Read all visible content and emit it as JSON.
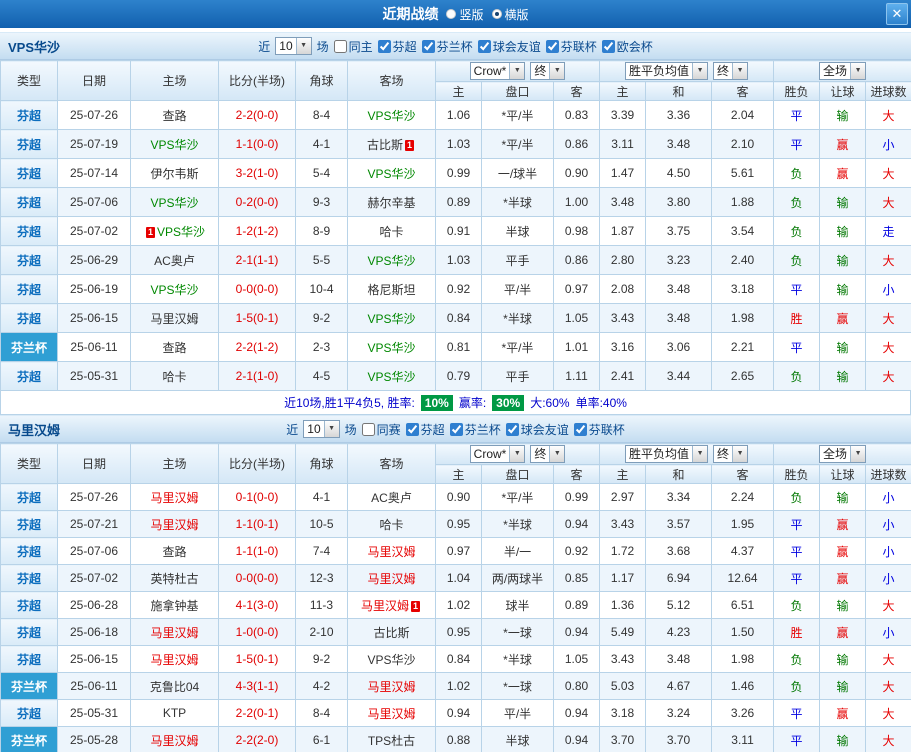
{
  "titlebar": {
    "title": "近期战绩",
    "vertical_label": "竖版",
    "horizontal_label": "横版",
    "selected_layout": "横版",
    "close_glyph": "✕"
  },
  "icons": {
    "chevron_down": "▼"
  },
  "colors": {
    "highlight_home_team": "#e60000",
    "highlight_away_team": "#008800",
    "result_win": "#e60000",
    "result_draw": "#0000e0",
    "result_lose": "#007700",
    "rate_badge_bg": "#009944",
    "cup_type_bg": "#2f9fd4",
    "titlebar_bg": "#1a6fbd"
  },
  "table_headers": {
    "type": "类型",
    "date": "日期",
    "home": "主场",
    "score": "比分(半场)",
    "corner": "角球",
    "away": "客场",
    "bookmaker": "Crow*",
    "final": "终",
    "avg": "胜平负均值",
    "fulltime": "全场",
    "sub_home": "主",
    "sub_handicap": "盘口",
    "sub_away": "客",
    "sub_avg_home": "主",
    "sub_avg_draw": "和",
    "sub_avg_away": "客",
    "sub_result": "胜负",
    "sub_handicap_result": "让球",
    "sub_goals": "进球数"
  },
  "sections": [
    {
      "team": "VPS华沙",
      "filters": {
        "near_label": "近",
        "count": "10",
        "games_label": "场",
        "same_label": "同主",
        "leagues": [
          "芬超",
          "芬兰杯",
          "球会友谊",
          "芬联杯",
          "欧会杯"
        ]
      },
      "rows": [
        {
          "type": "芬超",
          "date": "25-07-26",
          "home": {
            "name": "查路"
          },
          "score": "2-2(0-0)",
          "corner": "8-4",
          "away": {
            "name": "VPS华沙",
            "hl": "green"
          },
          "odds": [
            "1.06",
            "*平/半",
            "0.83",
            "3.39",
            "3.36",
            "2.04"
          ],
          "res": [
            "平",
            "输",
            "大"
          ]
        },
        {
          "type": "芬超",
          "date": "25-07-19",
          "home": {
            "name": "VPS华沙",
            "hl": "green"
          },
          "score": "1-1(0-0)",
          "corner": "4-1",
          "away": {
            "name": "古比斯",
            "card_after": "1"
          },
          "odds": [
            "1.03",
            "*平/半",
            "0.86",
            "3.11",
            "3.48",
            "2.10"
          ],
          "res": [
            "平",
            "赢",
            "小"
          ]
        },
        {
          "type": "芬超",
          "date": "25-07-14",
          "home": {
            "name": "伊尔韦斯"
          },
          "score": "3-2(1-0)",
          "corner": "5-4",
          "away": {
            "name": "VPS华沙",
            "hl": "green"
          },
          "odds": [
            "0.99",
            "一/球半",
            "0.90",
            "1.47",
            "4.50",
            "5.61"
          ],
          "res": [
            "负",
            "赢",
            "大"
          ]
        },
        {
          "type": "芬超",
          "date": "25-07-06",
          "home": {
            "name": "VPS华沙",
            "hl": "green"
          },
          "score": "0-2(0-0)",
          "corner": "9-3",
          "away": {
            "name": "赫尔辛基"
          },
          "odds": [
            "0.89",
            "*半球",
            "1.00",
            "3.48",
            "3.80",
            "1.88"
          ],
          "res": [
            "负",
            "输",
            "大"
          ]
        },
        {
          "type": "芬超",
          "date": "25-07-02",
          "home": {
            "name": "VPS华沙",
            "hl": "green",
            "card_before": "1"
          },
          "score": "1-2(1-2)",
          "corner": "8-9",
          "away": {
            "name": "哈卡"
          },
          "odds": [
            "0.91",
            "半球",
            "0.98",
            "1.87",
            "3.75",
            "3.54"
          ],
          "res": [
            "负",
            "输",
            "走"
          ]
        },
        {
          "type": "芬超",
          "date": "25-06-29",
          "home": {
            "name": "AC奥卢"
          },
          "score": "2-1(1-1)",
          "corner": "5-5",
          "away": {
            "name": "VPS华沙",
            "hl": "green"
          },
          "odds": [
            "1.03",
            "平手",
            "0.86",
            "2.80",
            "3.23",
            "2.40"
          ],
          "res": [
            "负",
            "输",
            "大"
          ]
        },
        {
          "type": "芬超",
          "date": "25-06-19",
          "home": {
            "name": "VPS华沙",
            "hl": "green"
          },
          "score": "0-0(0-0)",
          "corner": "10-4",
          "away": {
            "name": "格尼斯坦"
          },
          "odds": [
            "0.92",
            "平/半",
            "0.97",
            "2.08",
            "3.48",
            "3.18"
          ],
          "res": [
            "平",
            "输",
            "小"
          ]
        },
        {
          "type": "芬超",
          "date": "25-06-15",
          "home": {
            "name": "马里汉姆"
          },
          "score": "1-5(0-1)",
          "corner": "9-2",
          "away": {
            "name": "VPS华沙",
            "hl": "green"
          },
          "odds": [
            "0.84",
            "*半球",
            "1.05",
            "3.43",
            "3.48",
            "1.98"
          ],
          "res": [
            "胜",
            "赢",
            "大"
          ]
        },
        {
          "type": "芬兰杯",
          "date": "25-06-11",
          "home": {
            "name": "查路"
          },
          "score": "2-2(1-2)",
          "corner": "2-3",
          "away": {
            "name": "VPS华沙",
            "hl": "green"
          },
          "odds": [
            "0.81",
            "*平/半",
            "1.01",
            "3.16",
            "3.06",
            "2.21"
          ],
          "res": [
            "平",
            "输",
            "大"
          ]
        },
        {
          "type": "芬超",
          "date": "25-05-31",
          "home": {
            "name": "哈卡"
          },
          "score": "2-1(1-0)",
          "corner": "4-5",
          "away": {
            "name": "VPS华沙",
            "hl": "green"
          },
          "odds": [
            "0.79",
            "平手",
            "1.11",
            "2.41",
            "3.44",
            "2.65"
          ],
          "res": [
            "负",
            "输",
            "大"
          ]
        }
      ],
      "summary": {
        "prefix": "近10场,胜1平4负5, 胜率:",
        "win_rate": "10%",
        "asia_label": "赢率:",
        "asia_rate": "30%",
        "big_text": "大:60%",
        "single_text": "单率:40%"
      }
    },
    {
      "team": "马里汉姆",
      "filters": {
        "near_label": "近",
        "count": "10",
        "games_label": "场",
        "same_label": "同赛",
        "leagues": [
          "芬超",
          "芬兰杯",
          "球会友谊",
          "芬联杯"
        ]
      },
      "rows": [
        {
          "type": "芬超",
          "date": "25-07-26",
          "home": {
            "name": "马里汉姆",
            "hl": "red"
          },
          "score": "0-1(0-0)",
          "corner": "4-1",
          "away": {
            "name": "AC奥卢"
          },
          "odds": [
            "0.90",
            "*平/半",
            "0.99",
            "2.97",
            "3.34",
            "2.24"
          ],
          "res": [
            "负",
            "输",
            "小"
          ]
        },
        {
          "type": "芬超",
          "date": "25-07-21",
          "home": {
            "name": "马里汉姆",
            "hl": "red"
          },
          "score": "1-1(0-1)",
          "corner": "10-5",
          "away": {
            "name": "哈卡"
          },
          "odds": [
            "0.95",
            "*半球",
            "0.94",
            "3.43",
            "3.57",
            "1.95"
          ],
          "res": [
            "平",
            "赢",
            "小"
          ]
        },
        {
          "type": "芬超",
          "date": "25-07-06",
          "home": {
            "name": "查路"
          },
          "score": "1-1(1-0)",
          "corner": "7-4",
          "away": {
            "name": "马里汉姆",
            "hl": "red"
          },
          "odds": [
            "0.97",
            "半/一",
            "0.92",
            "1.72",
            "3.68",
            "4.37"
          ],
          "res": [
            "平",
            "赢",
            "小"
          ]
        },
        {
          "type": "芬超",
          "date": "25-07-02",
          "home": {
            "name": "英特杜古"
          },
          "score": "0-0(0-0)",
          "corner": "12-3",
          "away": {
            "name": "马里汉姆",
            "hl": "red"
          },
          "odds": [
            "1.04",
            "两/两球半",
            "0.85",
            "1.17",
            "6.94",
            "12.64"
          ],
          "res": [
            "平",
            "赢",
            "小"
          ]
        },
        {
          "type": "芬超",
          "date": "25-06-28",
          "home": {
            "name": "施拿钟基"
          },
          "score": "4-1(3-0)",
          "corner": "11-3",
          "away": {
            "name": "马里汉姆",
            "hl": "red",
            "card_after": "1"
          },
          "odds": [
            "1.02",
            "球半",
            "0.89",
            "1.36",
            "5.12",
            "6.51"
          ],
          "res": [
            "负",
            "输",
            "大"
          ]
        },
        {
          "type": "芬超",
          "date": "25-06-18",
          "home": {
            "name": "马里汉姆",
            "hl": "red"
          },
          "score": "1-0(0-0)",
          "corner": "2-10",
          "away": {
            "name": "古比斯"
          },
          "odds": [
            "0.95",
            "*一球",
            "0.94",
            "5.49",
            "4.23",
            "1.50"
          ],
          "res": [
            "胜",
            "赢",
            "小"
          ]
        },
        {
          "type": "芬超",
          "date": "25-06-15",
          "home": {
            "name": "马里汉姆",
            "hl": "red"
          },
          "score": "1-5(0-1)",
          "corner": "9-2",
          "away": {
            "name": "VPS华沙"
          },
          "odds": [
            "0.84",
            "*半球",
            "1.05",
            "3.43",
            "3.48",
            "1.98"
          ],
          "res": [
            "负",
            "输",
            "大"
          ]
        },
        {
          "type": "芬兰杯",
          "date": "25-06-11",
          "home": {
            "name": "克鲁比04"
          },
          "score": "4-3(1-1)",
          "corner": "4-2",
          "away": {
            "name": "马里汉姆",
            "hl": "red"
          },
          "odds": [
            "1.02",
            "*一球",
            "0.80",
            "5.03",
            "4.67",
            "1.46"
          ],
          "res": [
            "负",
            "输",
            "大"
          ]
        },
        {
          "type": "芬超",
          "date": "25-05-31",
          "home": {
            "name": "KTP"
          },
          "score": "2-2(0-1)",
          "corner": "8-4",
          "away": {
            "name": "马里汉姆",
            "hl": "red"
          },
          "odds": [
            "0.94",
            "平/半",
            "0.94",
            "3.18",
            "3.24",
            "3.26"
          ],
          "res": [
            "平",
            "赢",
            "大"
          ]
        },
        {
          "type": "芬兰杯",
          "date": "25-05-28",
          "home": {
            "name": "马里汉姆",
            "hl": "red"
          },
          "score": "2-2(2-0)",
          "corner": "6-1",
          "away": {
            "name": "TPS杜古"
          },
          "odds": [
            "0.88",
            "半球",
            "0.94",
            "3.70",
            "3.70",
            "3.11"
          ],
          "res": [
            "平",
            "输",
            "大"
          ]
        }
      ]
    }
  ]
}
